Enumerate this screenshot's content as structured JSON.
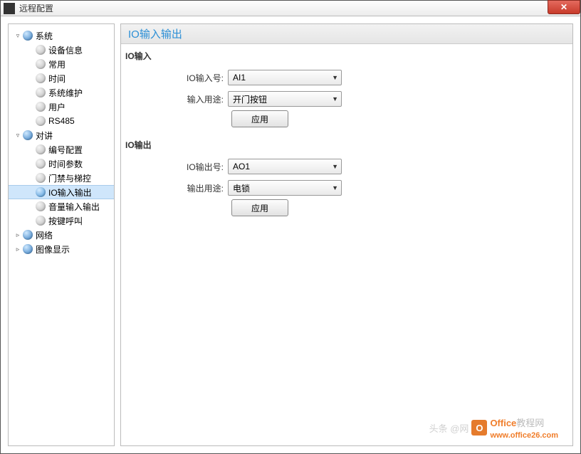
{
  "window": {
    "title": "远程配置"
  },
  "tree": {
    "system": {
      "label": "系统",
      "items": {
        "deviceInfo": "设备信息",
        "common": "常用",
        "time": "时间",
        "maintenance": "系统维护",
        "user": "用户",
        "rs485": "RS485"
      }
    },
    "intercom": {
      "label": "对讲",
      "items": {
        "numberConfig": "编号配置",
        "timeParams": "时间参数",
        "accessLift": "门禁与梯控",
        "ioInOut": "IO输入输出",
        "volumeInOut": "音量输入输出",
        "keyCall": "按键呼叫"
      }
    },
    "network": {
      "label": "网络"
    },
    "imageDisplay": {
      "label": "图像显示"
    }
  },
  "main": {
    "header": "IO输入输出",
    "ioInput": {
      "section": "IO输入",
      "ioNumLabel": "IO输入号:",
      "ioNumValue": "AI1",
      "usageLabel": "输入用途:",
      "usageValue": "开门按钮",
      "apply": "应用"
    },
    "ioOutput": {
      "section": "IO输出",
      "ioNumLabel": "IO输出号:",
      "ioNumValue": "AO1",
      "usageLabel": "输出用途:",
      "usageValue": "电锁",
      "apply": "应用"
    }
  },
  "watermark": {
    "left": "头条 @网",
    "brand1": "Office",
    "brand2": "教程网",
    "url": "www.office26.com"
  }
}
